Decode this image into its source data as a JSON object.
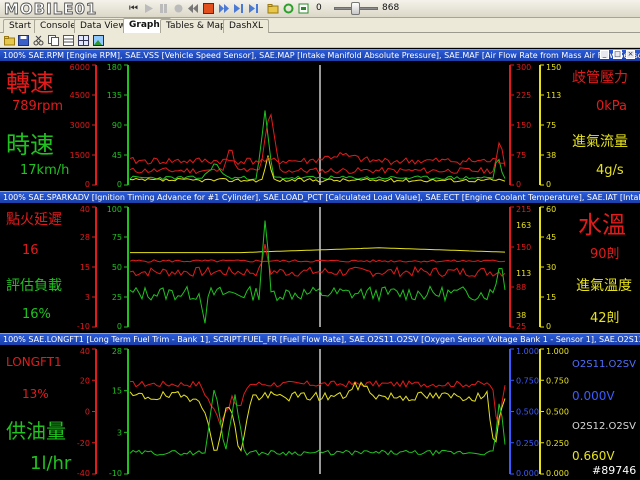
{
  "app": {
    "logo_text": "MOBILE01",
    "slider": {
      "min_label": "0",
      "max_label": "868"
    }
  },
  "tabs": [
    {
      "label": "Start"
    },
    {
      "label": "Console"
    },
    {
      "label": "Data View"
    },
    {
      "label": "Graphs",
      "active": true
    },
    {
      "label": "Tables & Maps"
    },
    {
      "label": "DashXL"
    }
  ],
  "colors": {
    "red": "#e31b1b",
    "green": "#20c220",
    "yellow": "#e6e21c",
    "blue": "#3b5bff",
    "cursor": "#ffffff"
  },
  "panels": [
    {
      "header": "100% SAE.RPM [Engine RPM], SAE.VSS [Vehicle Speed Sensor], SAE.MAP [Intake Manifold Absolute Pressure], SAE.MAF [Air Flow Rate from Mass Air Flow Sensor]",
      "left": [
        {
          "name": "轉速",
          "value": "789rpm",
          "color": "red"
        },
        {
          "name": "時速",
          "value": "17km/h",
          "color": "green"
        }
      ],
      "right": [
        {
          "name": "歧管壓力",
          "value": "0kPa",
          "color": "red"
        },
        {
          "name": "進氣流量",
          "value": "4g/s",
          "color": "yellow"
        }
      ],
      "axes": {
        "a1": {
          "color": "red",
          "ticks": [
            "6000",
            "4500",
            "3000",
            "1500",
            "0"
          ]
        },
        "a2": {
          "color": "green",
          "ticks": [
            "180",
            "135",
            "90",
            "45",
            "0"
          ]
        },
        "a3": {
          "color": "red",
          "ticks": [
            "300",
            "225",
            "150",
            "75",
            "0"
          ]
        },
        "a4": {
          "color": "yellow",
          "ticks": [
            "150",
            "113",
            "75",
            "38",
            "0"
          ]
        }
      }
    },
    {
      "header": "100% SAE.SPARKADV [Ignition Timing Advance for #1 Cylinder], SAE.LOAD_PCT [Calculated Load Value], SAE.ECT [Engine Coolant Temperature], SAE.IAT [Intake Air Te…",
      "left": [
        {
          "name": "點火延遲",
          "value": "16",
          "color": "red"
        },
        {
          "name": "評估負載",
          "value": "16%",
          "color": "green"
        }
      ],
      "right": [
        {
          "name": "水溫",
          "value": "90剆",
          "color": "red"
        },
        {
          "name": "進氣溫度",
          "value": "42剆",
          "color": "yellow"
        }
      ],
      "axes": {
        "a1": {
          "color": "red",
          "ticks": [
            "40",
            "28",
            "15",
            "3",
            "-10"
          ]
        },
        "a2": {
          "color": "green",
          "ticks": [
            "100",
            "75",
            "50",
            "25",
            "0"
          ]
        },
        "a3": {
          "color": "red",
          "ticks": [
            "215",
            "150",
            "88",
            "25"
          ]
        },
        "a4": {
          "color": "yellow",
          "ticks": [
            "60",
            "45",
            "30",
            "15",
            "0"
          ]
        },
        "a3_extra": {
          "color": "yellow",
          "ticks": [
            "163",
            "113",
            "38"
          ]
        }
      }
    },
    {
      "header": "100% SAE.LONGFT1 [Long Term Fuel Trim - Bank 1], SCRIPT.FUEL_FR [Fuel Flow Rate], SAE.O2S11.O2SV [Oxygen Sensor Voltage Bank 1 - Sensor 1], SAE.O2S12.O2SV …",
      "left": [
        {
          "name": "LONGFT1",
          "value": "13%",
          "color": "red"
        },
        {
          "name": "供油量",
          "value": "1l/hr",
          "color": "green"
        }
      ],
      "right": [
        {
          "name": "O2S11.O2SV",
          "value": "0.000V",
          "color": "blue"
        },
        {
          "name": "O2S12.O2SV",
          "value": "0.660V",
          "color": "yellow"
        }
      ],
      "axes": {
        "a1": {
          "color": "red",
          "ticks": [
            "40",
            "20",
            "0",
            "-20",
            "-40"
          ]
        },
        "a2": {
          "color": "green",
          "ticks": [
            "28",
            "15",
            "3",
            "-10"
          ]
        },
        "a3": {
          "color": "blue",
          "ticks": [
            "1.000",
            "0.750",
            "0.500",
            "0.250",
            "0.000"
          ]
        },
        "a4": {
          "color": "yellow",
          "ticks": [
            "1.000",
            "0.750",
            "0.500",
            "0.250",
            "0.000"
          ]
        }
      }
    }
  ],
  "watermark": "#89746"
}
